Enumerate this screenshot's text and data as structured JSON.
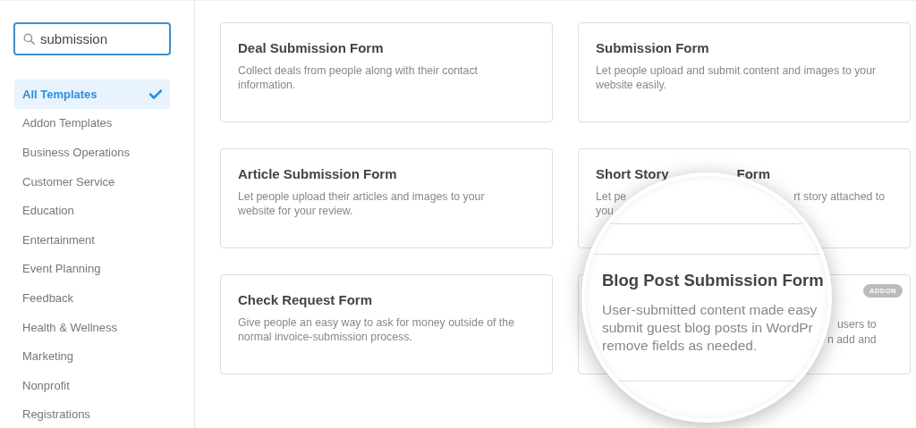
{
  "sidebar": {
    "search": {
      "value": "submission"
    },
    "categories": [
      {
        "label": "All Templates",
        "selected": true
      },
      {
        "label": "Addon Templates",
        "selected": false
      },
      {
        "label": "Business Operations",
        "selected": false
      },
      {
        "label": "Customer Service",
        "selected": false
      },
      {
        "label": "Education",
        "selected": false
      },
      {
        "label": "Entertainment",
        "selected": false
      },
      {
        "label": "Event Planning",
        "selected": false
      },
      {
        "label": "Feedback",
        "selected": false
      },
      {
        "label": "Health & Wellness",
        "selected": false
      },
      {
        "label": "Marketing",
        "selected": false
      },
      {
        "label": "Nonprofit",
        "selected": false
      },
      {
        "label": "Registrations",
        "selected": false
      }
    ]
  },
  "templates": [
    {
      "kind": "full",
      "title": "Deal Submission Form",
      "description": "Collect deals from people along with their contact information."
    },
    {
      "kind": "full",
      "title": "Submission Form",
      "description": "Let people upload and submit content and images to your website easily."
    },
    {
      "kind": "full",
      "title": "Article Submission Form",
      "description": "Let people upload their articles and images to your website for your review."
    },
    {
      "kind": "covered",
      "title_parts": [
        "Short Story",
        "Form"
      ],
      "description_parts": [
        "Let pe",
        "rt story attached to",
        "you"
      ]
    },
    {
      "kind": "full",
      "title": "Check Request Form",
      "description": "Give people an easy way to ask for money outside of the normal invoice-submission process."
    },
    {
      "kind": "covered_addon",
      "badge": "ADDON",
      "description_parts": [
        "users to",
        "n add and"
      ]
    }
  ],
  "magnifier": {
    "title": "Blog Post Submission Form",
    "description_lines": [
      "User-submitted content made easy",
      "submit guest blog posts in WordPr",
      "remove fields as needed."
    ]
  }
}
